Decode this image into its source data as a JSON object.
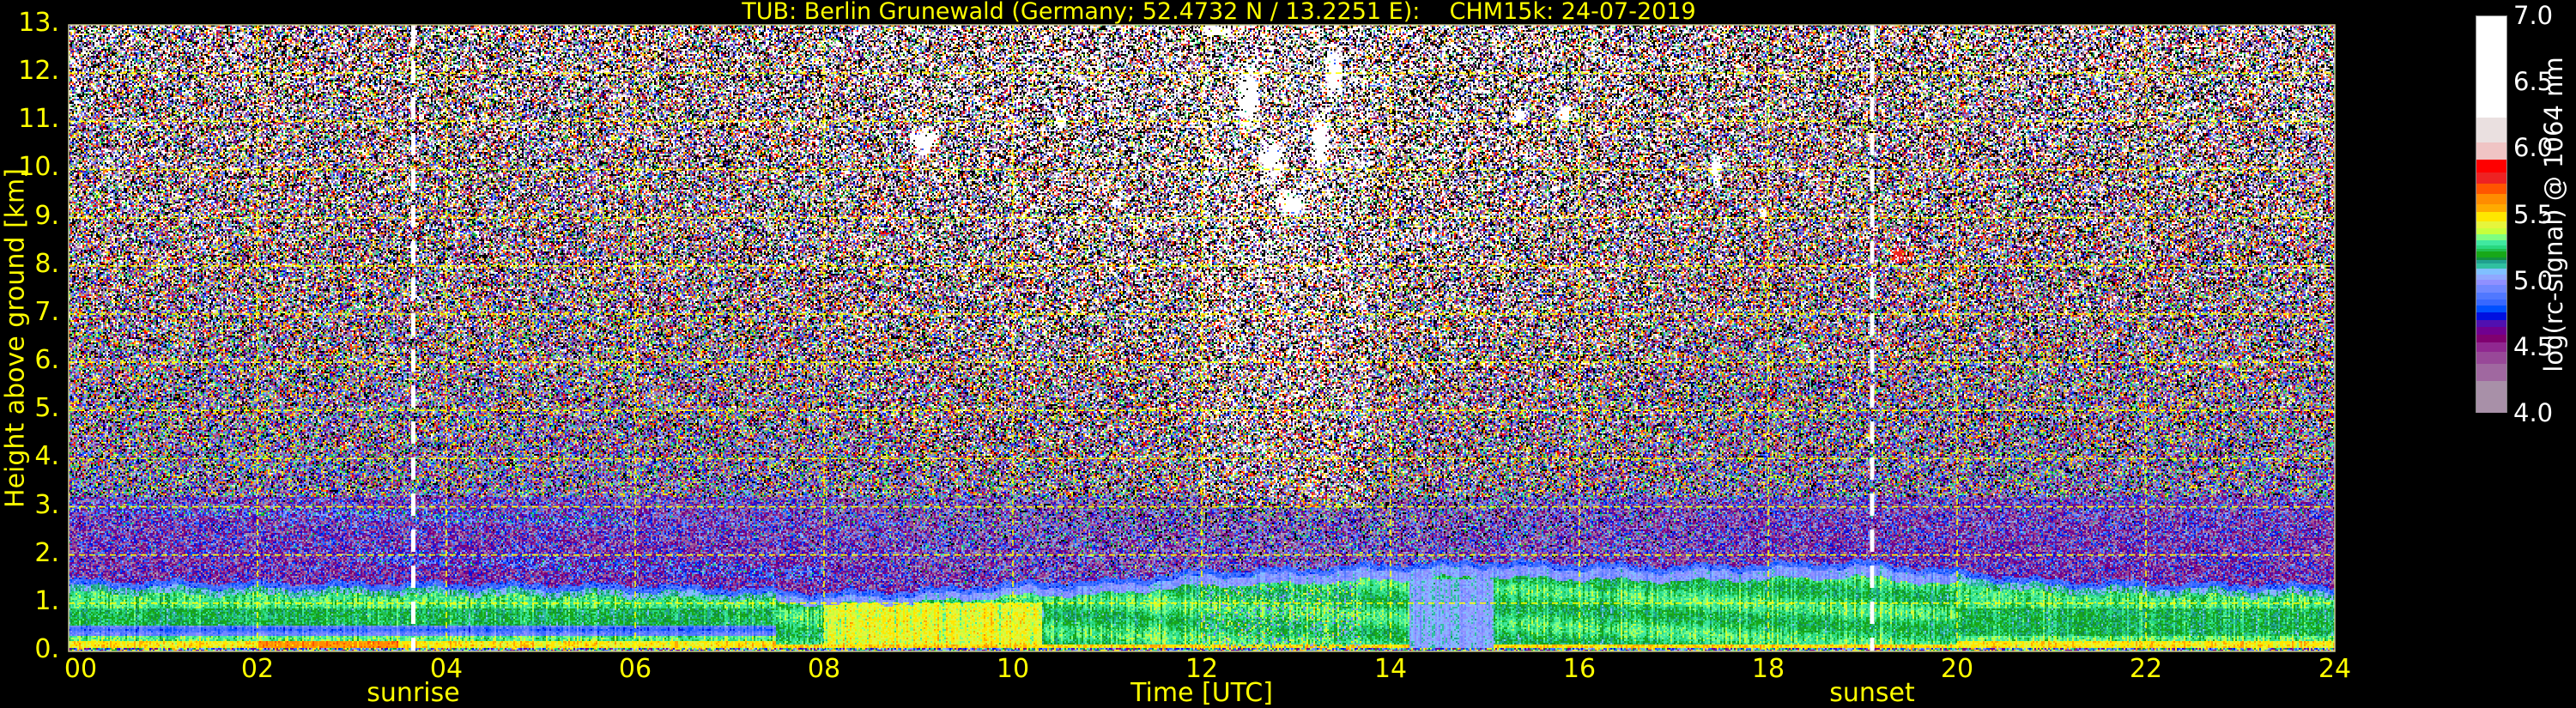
{
  "chart_data": {
    "type": "heatmap",
    "title": "TUB: Berlin Grunewald (Germany; 52.4732 N / 13.2251 E):    CHM15k: 24-07-2019",
    "xlabel": "Time [UTC]",
    "ylabel": "Height above ground [km]",
    "xlim": [
      0,
      24
    ],
    "ylim": [
      0,
      13
    ],
    "x_ticks": [
      0,
      2,
      4,
      6,
      8,
      10,
      12,
      14,
      16,
      18,
      20,
      22,
      24
    ],
    "x_tick_labels": [
      "00",
      "02",
      "04",
      "06",
      "08",
      "10",
      "12",
      "14",
      "16",
      "18",
      "20",
      "22",
      "24"
    ],
    "y_ticks": [
      0,
      1,
      2,
      3,
      4,
      5,
      6,
      7,
      8,
      9,
      10,
      11,
      12,
      13
    ],
    "y_tick_labels": [
      "0.",
      "1.",
      "2.",
      "3.",
      "4.",
      "5.",
      "6.",
      "7.",
      "8.",
      "9.",
      "10.",
      "11.",
      "12.",
      "13."
    ],
    "grid": true,
    "grid_color": "#ffff00",
    "markers": [
      {
        "label": "sunrise",
        "time_utc": 3.65,
        "color": "#ffffff"
      },
      {
        "label": "sunset",
        "time_utc": 19.1,
        "color": "#ffffff"
      }
    ],
    "colorbar": {
      "label": "log(rc-signal) @ 1064 nm",
      "range": [
        4.0,
        7.0
      ],
      "ticks": [
        4.0,
        4.5,
        5.0,
        5.5,
        6.0,
        6.5,
        7.0
      ],
      "tick_labels": [
        "4.0",
        "4.5",
        "5.0",
        "5.5",
        "6.0",
        "6.5",
        "7.0"
      ],
      "placement": "right",
      "bands": [
        {
          "from": 4.0,
          "to": 4.24,
          "color": "#a890a8"
        },
        {
          "from": 4.24,
          "to": 4.37,
          "color": "#a068a0"
        },
        {
          "from": 4.37,
          "to": 4.46,
          "color": "#984898"
        },
        {
          "from": 4.46,
          "to": 4.53,
          "color": "#902890"
        },
        {
          "from": 4.53,
          "to": 4.59,
          "color": "#800070"
        },
        {
          "from": 4.59,
          "to": 4.65,
          "color": "#700090"
        },
        {
          "from": 4.65,
          "to": 4.7,
          "color": "#5010b0"
        },
        {
          "from": 4.7,
          "to": 4.76,
          "color": "#0010e0"
        },
        {
          "from": 4.76,
          "to": 4.81,
          "color": "#0050ff"
        },
        {
          "from": 4.81,
          "to": 4.86,
          "color": "#3868ff"
        },
        {
          "from": 4.86,
          "to": 4.91,
          "color": "#5078ff"
        },
        {
          "from": 4.91,
          "to": 4.97,
          "color": "#7088ff"
        },
        {
          "from": 4.97,
          "to": 5.01,
          "color": "#9090ff"
        },
        {
          "from": 5.01,
          "to": 5.05,
          "color": "#90a8ff"
        },
        {
          "from": 5.05,
          "to": 5.09,
          "color": "#80c0ff"
        },
        {
          "from": 5.09,
          "to": 5.13,
          "color": "#30c0a0"
        },
        {
          "from": 5.13,
          "to": 5.16,
          "color": "#20a090"
        },
        {
          "from": 5.16,
          "to": 5.18,
          "color": "#109040"
        },
        {
          "from": 5.18,
          "to": 5.22,
          "color": "#18a818"
        },
        {
          "from": 5.22,
          "to": 5.24,
          "color": "#20c050"
        },
        {
          "from": 5.24,
          "to": 5.27,
          "color": "#28d880"
        },
        {
          "from": 5.27,
          "to": 5.31,
          "color": "#40e8a0"
        },
        {
          "from": 5.31,
          "to": 5.35,
          "color": "#80ff80"
        },
        {
          "from": 5.35,
          "to": 5.4,
          "color": "#c8ff3c"
        },
        {
          "from": 5.4,
          "to": 5.45,
          "color": "#e6f53c"
        },
        {
          "from": 5.45,
          "to": 5.52,
          "color": "#ffe600"
        },
        {
          "from": 5.52,
          "to": 5.58,
          "color": "#ffaa00"
        },
        {
          "from": 5.58,
          "to": 5.66,
          "color": "#ff8c00"
        },
        {
          "from": 5.66,
          "to": 5.74,
          "color": "#ff5500"
        },
        {
          "from": 5.74,
          "to": 5.82,
          "color": "#ee2222"
        },
        {
          "from": 5.82,
          "to": 5.92,
          "color": "#ff0000"
        },
        {
          "from": 5.92,
          "to": 6.05,
          "color": "#f0c4c4"
        },
        {
          "from": 6.05,
          "to": 6.24,
          "color": "#eae0e0"
        },
        {
          "from": 6.24,
          "to": 7.0,
          "color": "#ffffff"
        }
      ]
    },
    "aerosol_layer_top_km": {
      "time_utc": [
        0,
        2,
        4,
        6,
        7,
        8,
        9,
        10,
        11,
        12,
        13,
        14,
        15,
        16,
        17,
        18,
        19,
        20,
        21,
        22,
        24
      ],
      "height_km": [
        1.35,
        1.3,
        1.3,
        1.25,
        1.2,
        1.1,
        1.15,
        1.3,
        1.35,
        1.55,
        1.6,
        1.7,
        1.75,
        1.7,
        1.65,
        1.7,
        1.75,
        1.55,
        1.35,
        1.3,
        1.25
      ]
    },
    "cloud_features": [
      {
        "time_utc": 9.05,
        "height_km": 10.6,
        "duration_h": 0.3,
        "thickness_km": 0.6,
        "value": 7.0
      },
      {
        "time_utc": 10.5,
        "height_km": 11.0,
        "duration_h": 0.12,
        "thickness_km": 0.3,
        "value": 7.0
      },
      {
        "time_utc": 11.1,
        "height_km": 9.3,
        "duration_h": 0.15,
        "thickness_km": 0.2,
        "value": 6.3
      },
      {
        "time_utc": 12.15,
        "height_km": 12.9,
        "duration_h": 0.35,
        "thickness_km": 0.25,
        "value": 7.0
      },
      {
        "time_utc": 12.5,
        "height_km": 11.5,
        "duration_h": 0.25,
        "thickness_km": 1.6,
        "value": 7.0
      },
      {
        "time_utc": 12.75,
        "height_km": 10.2,
        "duration_h": 0.3,
        "thickness_km": 1.0,
        "value": 7.0
      },
      {
        "time_utc": 12.95,
        "height_km": 9.3,
        "duration_h": 0.35,
        "thickness_km": 0.6,
        "value": 7.0
      },
      {
        "time_utc": 13.25,
        "height_km": 10.6,
        "duration_h": 0.2,
        "thickness_km": 1.4,
        "value": 7.0
      },
      {
        "time_utc": 13.4,
        "height_km": 12.0,
        "duration_h": 0.2,
        "thickness_km": 1.2,
        "value": 7.0
      },
      {
        "time_utc": 15.35,
        "height_km": 11.1,
        "duration_h": 0.2,
        "thickness_km": 0.3,
        "value": 7.0
      },
      {
        "time_utc": 15.85,
        "height_km": 11.2,
        "duration_h": 0.15,
        "thickness_km": 0.4,
        "value": 7.0
      },
      {
        "time_utc": 17.45,
        "height_km": 10.0,
        "duration_h": 0.12,
        "thickness_km": 0.8,
        "value": 7.0
      },
      {
        "time_utc": 17.95,
        "height_km": 9.1,
        "duration_h": 0.08,
        "thickness_km": 0.3,
        "value": 7.0
      },
      {
        "time_utc": 19.4,
        "height_km": 8.2,
        "duration_h": 0.25,
        "thickness_km": 0.35,
        "value": 5.8
      }
    ]
  }
}
